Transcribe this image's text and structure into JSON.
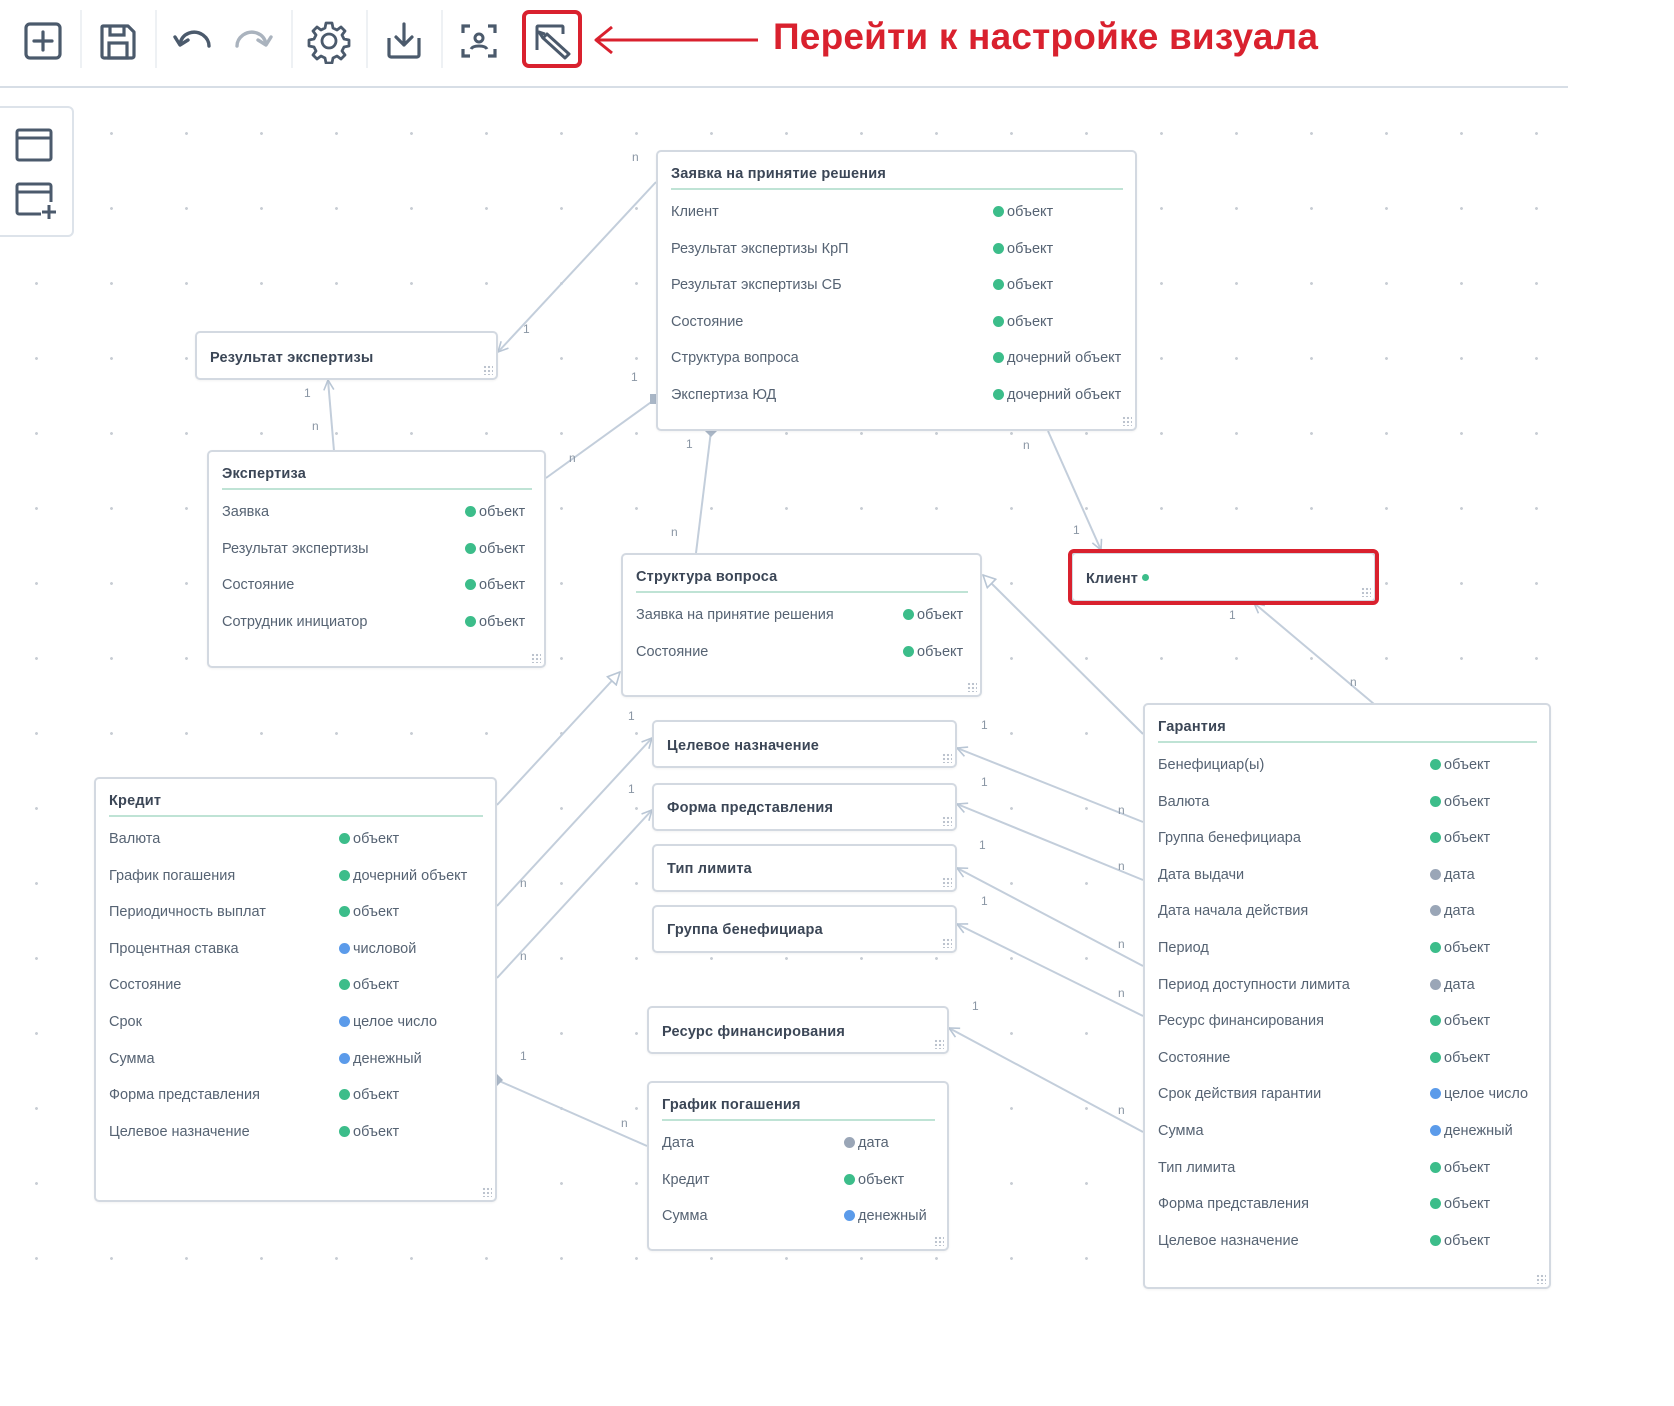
{
  "toolbar": {
    "buttons": [
      {
        "name": "add-entity-button",
        "icon": "plus-square-icon"
      },
      {
        "name": "save-button",
        "icon": "floppy-disk-icon"
      },
      {
        "name": "undo-button",
        "icon": "undo-icon"
      },
      {
        "name": "redo-button",
        "icon": "redo-icon"
      },
      {
        "name": "settings-button",
        "icon": "gear-icon"
      },
      {
        "name": "download-button",
        "icon": "download-icon"
      },
      {
        "name": "focus-button",
        "icon": "focus-frame-icon"
      },
      {
        "name": "visual-settings-button",
        "icon": "edit-visual-icon"
      }
    ],
    "annotation": "Перейти к настройке визуала"
  },
  "left_panel": {
    "items": [
      {
        "name": "window-icon"
      },
      {
        "name": "add-window-icon"
      }
    ]
  },
  "colors": {
    "accent_red": "#d9212e",
    "dot_object": "#3cbd8a",
    "dot_date": "#9aa6b7",
    "dot_number": "#5b9bea",
    "link": "#c3cedb",
    "title_rule": "#bfe3d5"
  },
  "entities": {
    "zayavka": {
      "title": "Заявка на принятие решения",
      "fields": [
        {
          "name": "Клиент",
          "type": "объект",
          "kind": "object"
        },
        {
          "name": "Результат экспертизы КрП",
          "type": "объект",
          "kind": "object"
        },
        {
          "name": "Результат экспертизы СБ",
          "type": "объект",
          "kind": "object"
        },
        {
          "name": "Состояние",
          "type": "объект",
          "kind": "object"
        },
        {
          "name": "Структура вопроса",
          "type": "дочерний объект",
          "kind": "object"
        },
        {
          "name": "Экспертиза ЮД",
          "type": "дочерний объект",
          "kind": "object"
        }
      ]
    },
    "rezultat": {
      "title": "Результат экспертизы",
      "fields": []
    },
    "ekspertiza": {
      "title": "Экспертиза",
      "fields": [
        {
          "name": "Заявка",
          "type": "объект",
          "kind": "object"
        },
        {
          "name": "Результат экспертизы",
          "type": "объект",
          "kind": "object"
        },
        {
          "name": "Состояние",
          "type": "объект",
          "kind": "object"
        },
        {
          "name": "Сотрудник инициатор",
          "type": "объект",
          "kind": "object"
        }
      ]
    },
    "struktura": {
      "title": "Структура вопроса",
      "fields": [
        {
          "name": "Заявка на принятие решения",
          "type": "объект",
          "kind": "object"
        },
        {
          "name": "Состояние",
          "type": "объект",
          "kind": "object"
        }
      ]
    },
    "klient": {
      "title": "Клиент",
      "fields": []
    },
    "celevoe": {
      "title": "Целевое назначение",
      "fields": []
    },
    "forma": {
      "title": "Форма представления",
      "fields": []
    },
    "tiplimita": {
      "title": "Тип лимита",
      "fields": []
    },
    "gruppa": {
      "title": "Группа бенефициара",
      "fields": []
    },
    "resurs": {
      "title": "Ресурс финансирования",
      "fields": []
    },
    "grafik": {
      "title": "График погашения",
      "fields": [
        {
          "name": "Дата",
          "type": "дата",
          "kind": "date"
        },
        {
          "name": "Кредит",
          "type": "объект",
          "kind": "object"
        },
        {
          "name": "Сумма",
          "type": "денежный",
          "kind": "number"
        }
      ]
    },
    "kredit": {
      "title": "Кредит",
      "fields": [
        {
          "name": "Валюта",
          "type": "объект",
          "kind": "object"
        },
        {
          "name": "График погашения",
          "type": "дочерний объект",
          "kind": "object"
        },
        {
          "name": "Периодичность выплат",
          "type": "объект",
          "kind": "object"
        },
        {
          "name": "Процентная ставка",
          "type": "числовой",
          "kind": "number"
        },
        {
          "name": "Состояние",
          "type": "объект",
          "kind": "object"
        },
        {
          "name": "Срок",
          "type": "целое число",
          "kind": "number"
        },
        {
          "name": "Сумма",
          "type": "денежный",
          "kind": "number"
        },
        {
          "name": "Форма представления",
          "type": "объект",
          "kind": "object"
        },
        {
          "name": "Целевое назначение",
          "type": "объект",
          "kind": "object"
        }
      ]
    },
    "garantiya": {
      "title": "Гарантия",
      "fields": [
        {
          "name": "Бенефициар(ы)",
          "type": "объект",
          "kind": "object"
        },
        {
          "name": "Валюта",
          "type": "объект",
          "kind": "object"
        },
        {
          "name": "Группа бенефициара",
          "type": "объект",
          "kind": "object"
        },
        {
          "name": "Дата выдачи",
          "type": "дата",
          "kind": "date"
        },
        {
          "name": "Дата начала действия",
          "type": "дата",
          "kind": "date"
        },
        {
          "name": "Период",
          "type": "объект",
          "kind": "object"
        },
        {
          "name": "Период доступности лимита",
          "type": "дата",
          "kind": "date"
        },
        {
          "name": "Ресурс финансирования",
          "type": "объект",
          "kind": "object"
        },
        {
          "name": "Состояние",
          "type": "объект",
          "kind": "object"
        },
        {
          "name": "Срок действия гарантии",
          "type": "целое число",
          "kind": "number"
        },
        {
          "name": "Сумма",
          "type": "денежный",
          "kind": "number"
        },
        {
          "name": "Тип лимита",
          "type": "объект",
          "kind": "object"
        },
        {
          "name": "Форма представления",
          "type": "объект",
          "kind": "object"
        },
        {
          "name": "Целевое назначение",
          "type": "объект",
          "kind": "object"
        }
      ]
    }
  },
  "links": [
    {
      "from": "zayavka",
      "to": "rezultat",
      "from_card": "n",
      "to_card": "1"
    },
    {
      "from": "ekspertiza",
      "to": "rezultat",
      "from_card": "n",
      "to_card": "1"
    },
    {
      "from": "ekspertiza",
      "to": "zayavka",
      "from_card": "n",
      "to_card": "1"
    },
    {
      "from": "struktura",
      "to": "zayavka",
      "from_card": "n",
      "to_card": "1"
    },
    {
      "from": "zayavka",
      "to": "klient",
      "from_card": "n",
      "to_card": "1"
    },
    {
      "from": "garantiya",
      "to": "klient",
      "from_card": "n",
      "to_card": "1"
    },
    {
      "from": "garantiya",
      "to": "struktura",
      "from_card": "",
      "to_card": ""
    },
    {
      "from": "kredit",
      "to": "struktura",
      "from_card": "",
      "to_card": "1"
    },
    {
      "from": "kredit",
      "to": "celevoe",
      "from_card": "n",
      "to_card": "1"
    },
    {
      "from": "kredit",
      "to": "forma",
      "from_card": "n",
      "to_card": "1"
    },
    {
      "from": "garantiya",
      "to": "celevoe",
      "from_card": "n",
      "to_card": "1"
    },
    {
      "from": "garantiya",
      "to": "forma",
      "from_card": "n",
      "to_card": "1"
    },
    {
      "from": "garantiya",
      "to": "tiplimita",
      "from_card": "n",
      "to_card": "1"
    },
    {
      "from": "garantiya",
      "to": "gruppa",
      "from_card": "n",
      "to_card": "1"
    },
    {
      "from": "garantiya",
      "to": "resurs",
      "from_card": "n",
      "to_card": "1"
    },
    {
      "from": "grafik",
      "to": "kredit",
      "from_card": "n",
      "to_card": "1"
    }
  ]
}
